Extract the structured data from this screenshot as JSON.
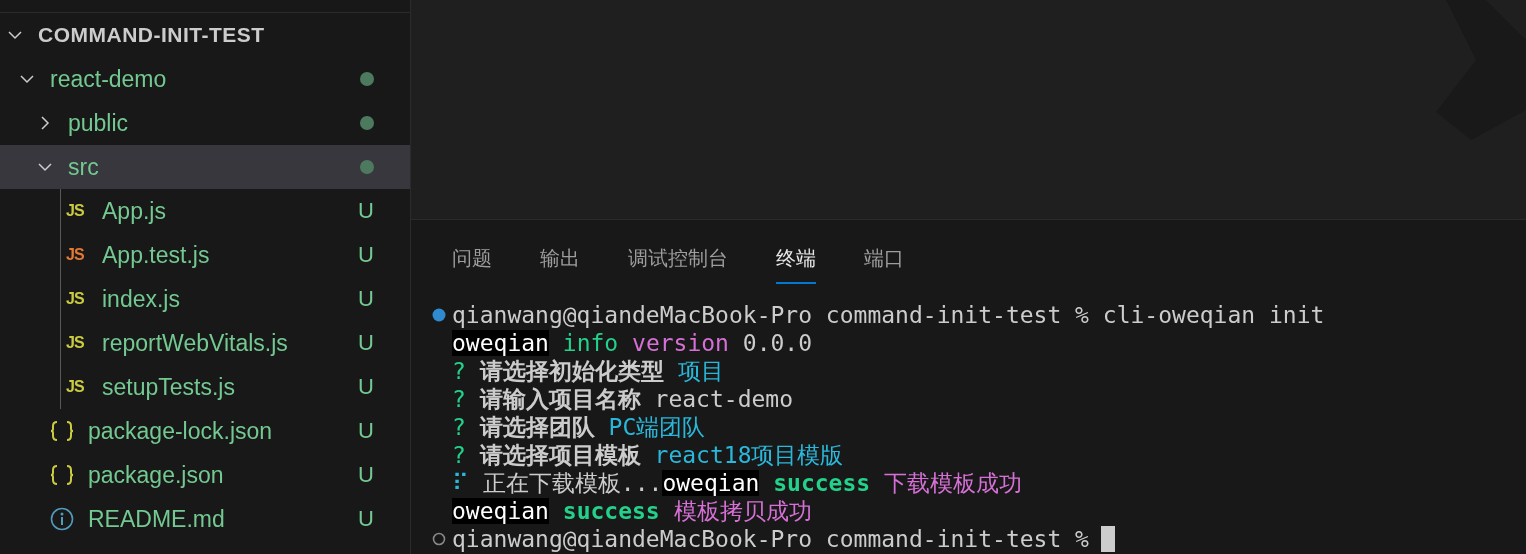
{
  "explorer": {
    "root": {
      "label": "COMMAND-INIT-TEST",
      "expanded": true
    },
    "tree": [
      {
        "label": "react-demo",
        "kind": "folder",
        "expanded": true,
        "dot": true,
        "selected": false,
        "children": [
          {
            "label": "public",
            "kind": "folder",
            "expanded": false,
            "dot": true,
            "selected": false
          },
          {
            "label": "src",
            "kind": "folder",
            "expanded": true,
            "dot": true,
            "selected": true,
            "children": [
              {
                "label": "App.js",
                "kind": "js",
                "icon": "JS",
                "color": "#cbcb41",
                "badge": "U",
                "selected": false
              },
              {
                "label": "App.test.js",
                "kind": "js",
                "icon": "JS",
                "color": "#e37933",
                "badge": "U",
                "selected": false
              },
              {
                "label": "index.js",
                "kind": "js",
                "icon": "JS",
                "color": "#cbcb41",
                "badge": "U",
                "selected": false
              },
              {
                "label": "reportWebVitals.js",
                "kind": "js",
                "icon": "JS",
                "color": "#cbcb41",
                "badge": "U",
                "selected": false
              },
              {
                "label": "setupTests.js",
                "kind": "js",
                "icon": "JS",
                "color": "#cbcb41",
                "badge": "U",
                "selected": false
              }
            ]
          },
          {
            "label": "package-lock.json",
            "kind": "json",
            "badge": "U",
            "selected": false
          },
          {
            "label": "package.json",
            "kind": "json",
            "badge": "U",
            "selected": false
          },
          {
            "label": "README.md",
            "kind": "info",
            "badge": "U",
            "selected": false
          }
        ]
      }
    ]
  },
  "panel": {
    "tabs": [
      {
        "label": "问题",
        "selected": false
      },
      {
        "label": "输出",
        "selected": false
      },
      {
        "label": "调试控制台",
        "selected": false
      },
      {
        "label": "终端",
        "selected": true
      },
      {
        "label": "端口",
        "selected": false
      }
    ],
    "terminal": [
      {
        "kind": "command",
        "segments": [
          {
            "text": "qianwang@qiandeMacBook-Pro command-init-test % cli-oweqian init",
            "kind": "plain"
          }
        ]
      },
      {
        "kind": "output",
        "segments": [
          {
            "text": "oweqian",
            "kind": "inverse"
          },
          {
            "text": " info",
            "kind": "green"
          },
          {
            "text": " version",
            "kind": "magenta"
          },
          {
            "text": " 0.0.0",
            "kind": "plain"
          }
        ]
      },
      {
        "kind": "output",
        "segments": [
          {
            "text": "? ",
            "kind": "green"
          },
          {
            "text": "请选择初始化类型",
            "kind": "bold"
          },
          {
            "text": " 项目",
            "kind": "cyan"
          }
        ]
      },
      {
        "kind": "output",
        "segments": [
          {
            "text": "? ",
            "kind": "green"
          },
          {
            "text": "请输入项目名称",
            "kind": "bold"
          },
          {
            "text": " react-demo",
            "kind": "plain"
          }
        ]
      },
      {
        "kind": "output",
        "segments": [
          {
            "text": "? ",
            "kind": "green"
          },
          {
            "text": "请选择团队",
            "kind": "bold"
          },
          {
            "text": " PC端团队",
            "kind": "cyan"
          }
        ]
      },
      {
        "kind": "output",
        "segments": [
          {
            "text": "? ",
            "kind": "green"
          },
          {
            "text": "请选择项目模板",
            "kind": "bold"
          },
          {
            "text": " react18项目模版",
            "kind": "cyan"
          }
        ]
      },
      {
        "kind": "output",
        "segments": [
          {
            "text": "⠏ ",
            "kind": "cyan"
          },
          {
            "text": "正在下载模板...",
            "kind": "plain"
          },
          {
            "text": "oweqian",
            "kind": "inverse"
          },
          {
            "text": " success",
            "kind": "greenbold"
          },
          {
            "text": " 下载模板成功",
            "kind": "magenta"
          }
        ]
      },
      {
        "kind": "output",
        "segments": [
          {
            "text": "oweqian",
            "kind": "inverse"
          },
          {
            "text": " success",
            "kind": "greenbold"
          },
          {
            "text": " 模板拷贝成功",
            "kind": "magenta"
          }
        ]
      },
      {
        "kind": "prompt",
        "segments": [
          {
            "text": "qianwang@qiandeMacBook-Pro command-init-test %",
            "kind": "plain"
          }
        ]
      }
    ]
  }
}
